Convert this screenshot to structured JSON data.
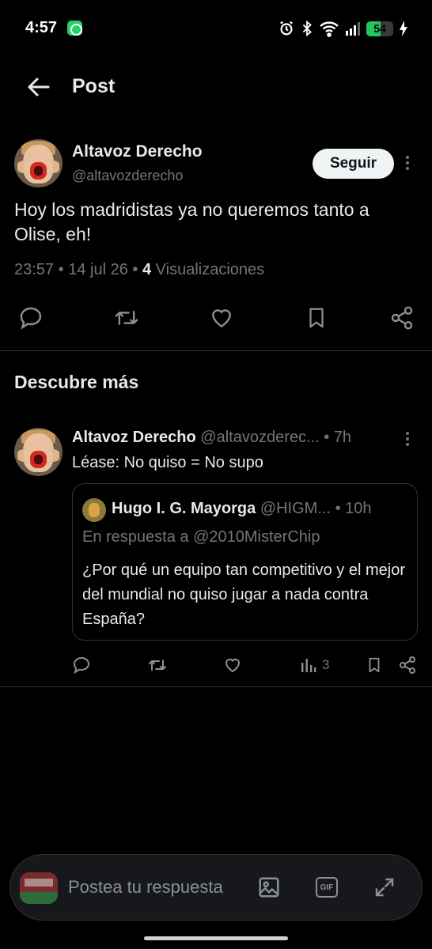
{
  "status_bar": {
    "time": "4:57",
    "battery": "54",
    "battery_level_percent": 54,
    "icons": [
      "whatsapp-icon",
      "alarm-icon",
      "bluetooth-icon",
      "wifi-icon",
      "signal-icon",
      "battery-icon",
      "charging-icon"
    ]
  },
  "header": {
    "title": "Post",
    "back_icon": "arrow-left-icon"
  },
  "post": {
    "author_name": "Altavoz Derecho",
    "author_handle": "@altavozderecho",
    "follow_label": "Seguir",
    "text": "Hoy los madridistas ya no queremos tanto a Olise, eh!",
    "time": "23:57",
    "date": "14 jul 26",
    "views_count": "4",
    "views_label": "Visualizaciones",
    "separator": "•"
  },
  "discover": {
    "title": "Descubre más",
    "tweet": {
      "author_name": "Altavoz Derecho",
      "author_handle": "@altavozderec...",
      "age": "7h",
      "separator": "•",
      "text": "Léase: No quiso = No supo",
      "quote": {
        "author_name": "Hugo I. G. Mayorga",
        "author_handle": "@HIGM...",
        "age": "10h",
        "separator": "•",
        "reply_to": "En respuesta a @2010MisterChip",
        "text": "¿Por qué un equipo tan competitivo y el mejor del mundial no quiso jugar a nada contra España?"
      },
      "views_count": "3"
    }
  },
  "composer": {
    "placeholder": "Postea tu respuesta",
    "gif_label": "GIF"
  },
  "colors": {
    "background": "#000000",
    "text": "#e7e9ea",
    "muted": "#71767b",
    "divider": "#2f3336",
    "battery": "#22c55e"
  }
}
